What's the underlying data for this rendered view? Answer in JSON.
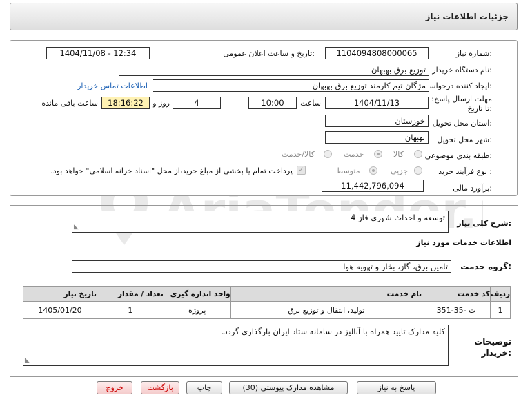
{
  "page": {
    "title": "جزئیات اطلاعات نیاز",
    "watermark": "AriaTender.neT"
  },
  "form": {
    "need_number": {
      "label": "شماره نیاز:",
      "value": "1104094808000065"
    },
    "announce_datetime": {
      "label": "تاریخ و ساعت اعلان عمومی:",
      "value": "1404/11/08 - 12:34"
    },
    "buyer_org": {
      "label": "نام دستگاه خریدار:",
      "value": "توزیع برق بهبهان"
    },
    "requester": {
      "label": "ایجاد کننده درخواست:",
      "value": "مژگان تیم کارمند توزیع برق بهبهان",
      "contact_link": "اطلاعات تماس خریدار"
    },
    "deadline": {
      "label": "مهلت ارسال پاسخ: تا تاریخ:",
      "date": "1404/11/13",
      "time_label": "ساعت",
      "time": "10:00",
      "days": "4",
      "days_label": "روز و",
      "remaining": "18:16:22",
      "remaining_label": "ساعت باقی مانده"
    },
    "province": {
      "label": "استان محل تحویل:",
      "value": "خوزستان"
    },
    "city": {
      "label": "شهر محل تحویل:",
      "value": "بهبهان"
    },
    "category": {
      "label": "طبقه بندی موضوعی:",
      "options": [
        "کالا",
        "خدمت",
        "کالا/خدمت"
      ],
      "selected": "خدمت"
    },
    "process_type": {
      "label": "نوع فرآیند خرید :",
      "options": [
        "جزیی",
        "متوسط"
      ],
      "selected": "متوسط",
      "payment_note": "پرداخت تمام یا بخشی از مبلغ خرید،از محل \"اسناد خزانه اسلامی\" خواهد بود."
    },
    "budget": {
      "label": "برآورد مالی:",
      "value": "11,442,796,094"
    }
  },
  "summary": {
    "label": "شرح کلی نیاز:",
    "value": "توسعه و احداث شهری فاز 4"
  },
  "services": {
    "section_title": "اطلاعات خدمات مورد نیاز",
    "group_label": "گروه خدمت:",
    "group_value": "تامین برق، گاز، بخار و تهویه هوا",
    "table": {
      "headers": [
        "ردیف",
        "کد خدمت",
        "نام خدمت",
        "واحد اندازه گیری",
        "تعداد / مقدار",
        "تاریخ نیاز"
      ],
      "rows": [
        [
          "1",
          "ت -35-351",
          "تولید، انتقال و توزیع برق",
          "پروژه",
          "1",
          "1405/01/20"
        ]
      ]
    }
  },
  "buyer_notes": {
    "label": "توضیحات خریدار:",
    "value": "کلیه مدارک تایید همراه با آنالیز در سامانه ستاد ایران بارگذاری گردد."
  },
  "buttons": {
    "reply": "پاسخ به نیاز",
    "attachments": "مشاهده مدارک پیوستی (30)",
    "print": "چاپ",
    "back": "بازگشت",
    "exit": "خروج"
  },
  "colors": {
    "remaining_bg": "#fff2b3",
    "link": "#1a5fb4",
    "table_header": "#dcdcdc",
    "danger_text": "#cc0000"
  }
}
